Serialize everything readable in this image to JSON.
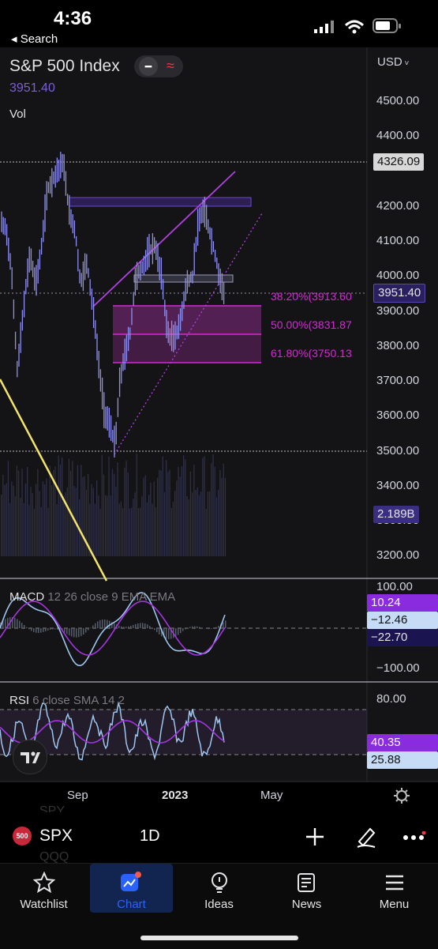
{
  "status_bar": {
    "time": "4:36",
    "back_label": "◂ Search"
  },
  "chart": {
    "symbol_title": "S&P 500 Index",
    "last_price": "3951.40",
    "volume_label": "Vol",
    "currency": "USD",
    "price_axis_labels": [
      "4500.00",
      "4400.00",
      "4200.00",
      "4100.00",
      "4000.00",
      "3900.00",
      "3800.00",
      "3700.00",
      "3600.00",
      "3500.00",
      "3400.00",
      "3300.00",
      "3200.00"
    ],
    "high_tag": "4326.09",
    "last_tag": "3951.40",
    "volume_tag": "2.189B",
    "fib_levels": [
      "38.20%(3913.60",
      "50.00%(3831.87",
      "61.80%(3750.13"
    ],
    "time_axis_labels": [
      "Sep",
      "2023",
      "May"
    ]
  },
  "macd": {
    "name": "MACD",
    "params": "12 26 close 9 EMA EMA",
    "axis_top": "100.00",
    "axis_bottom": "−100.00",
    "tag_macd": "10.24",
    "tag_signal": "−12.46",
    "tag_hist": "−22.70"
  },
  "rsi": {
    "name": "RSI",
    "params": "6 close SMA 14 2",
    "axis_top": "80.00",
    "tag_rsi": "40.35",
    "tag_ma": "25.88"
  },
  "toolbar": {
    "badge": "500",
    "symbol": "SPX",
    "interval": "1D",
    "ghost_top": "SPY",
    "ghost_bottom": "QQQ"
  },
  "tabs": [
    {
      "label": "Watchlist",
      "icon": "star-icon"
    },
    {
      "label": "Chart",
      "icon": "chart-icon"
    },
    {
      "label": "Ideas",
      "icon": "lightbulb-icon"
    },
    {
      "label": "News",
      "icon": "news-icon"
    },
    {
      "label": "Menu",
      "icon": "menu-icon"
    }
  ],
  "colors": {
    "background": "#141416",
    "candle": "#8f8ff0",
    "fib": "#d32bd3",
    "trend": "#f4e46b",
    "accent": "#2962ff"
  }
}
